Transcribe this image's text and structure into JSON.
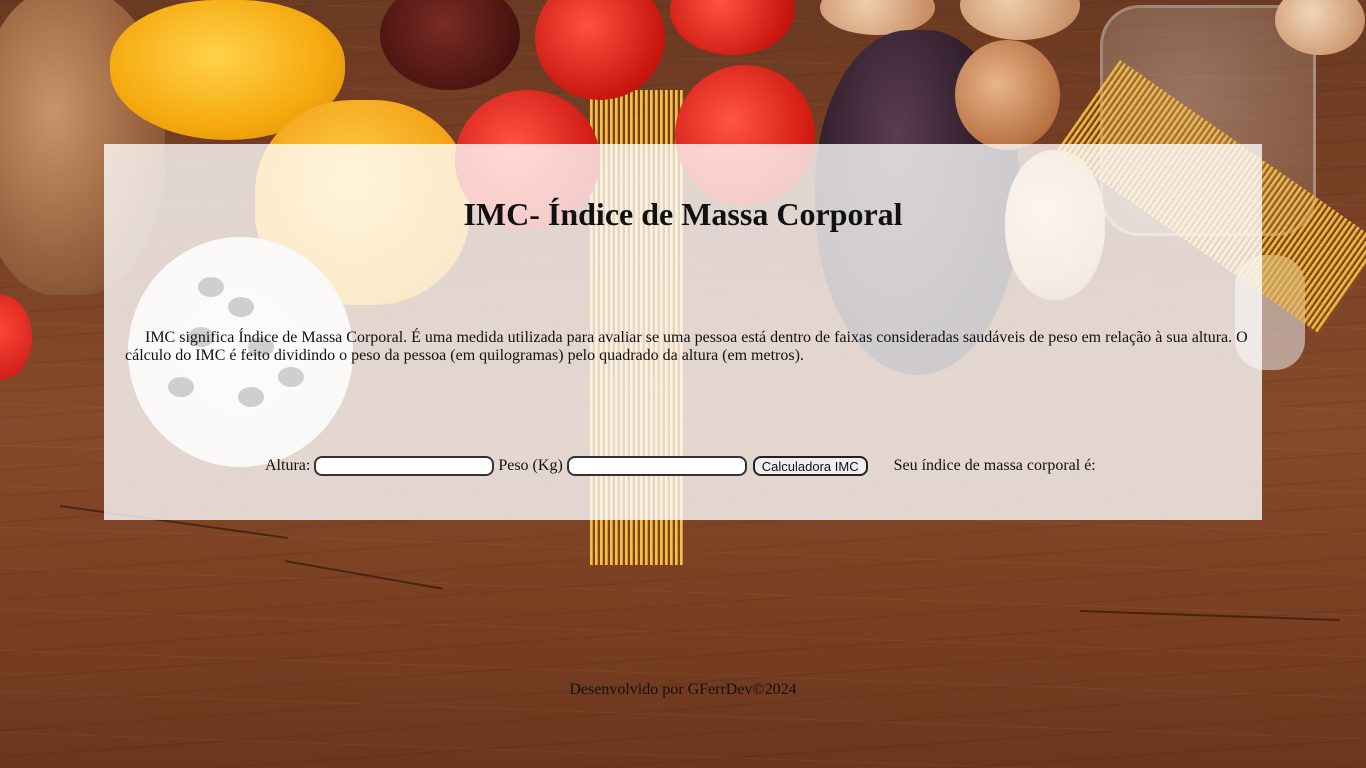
{
  "header": {
    "title": "IMC- Índice de Massa Corporal"
  },
  "main": {
    "description": "IMC significa Índice de Massa Corporal. É uma medida utilizada para avaliar se uma pessoa está dentro de faixas consideradas saudáveis de peso em relação à sua altura. O cálculo do IMC é feito dividindo o peso da pessoa (em quilogramas) pelo quadrado da altura (em metros).",
    "form": {
      "height_label": "Altura:",
      "height_value": "",
      "weight_label": "Peso (Kg)",
      "weight_value": "",
      "calculate_button": "Calculadora IMC",
      "result_label": "Seu índice de massa corporal é:"
    }
  },
  "footer": {
    "credit": "Desenvolvido por GFerrDev©2024"
  }
}
